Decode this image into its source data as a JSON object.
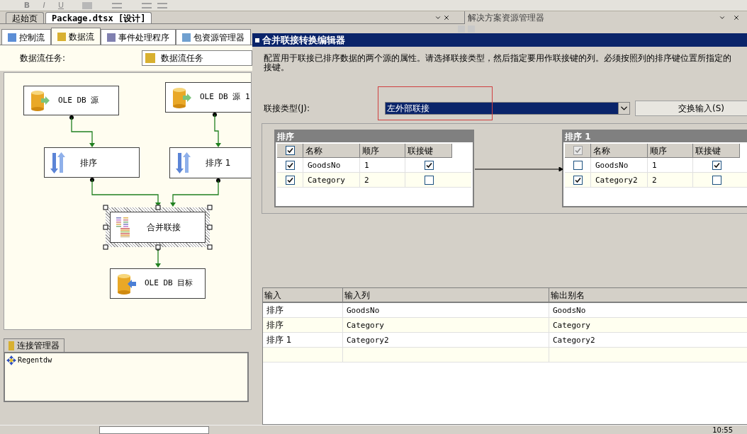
{
  "toolbar": {
    "buttons": [
      "B",
      "I",
      "U"
    ]
  },
  "document_tabs": [
    {
      "label": "起始页",
      "selected": false
    },
    {
      "label": "Package.dtsx [设计]",
      "selected": true
    }
  ],
  "solution_explorer": {
    "title": "解决方案资源管理器"
  },
  "designer_tabs": [
    {
      "label": "控制流",
      "selected": false
    },
    {
      "label": "数据流",
      "selected": true
    },
    {
      "label": "事件处理程序",
      "selected": false
    },
    {
      "label": "包资源管理器",
      "selected": false
    }
  ],
  "task": {
    "label": "数据流任务:",
    "value": "数据流任务"
  },
  "diagram": {
    "nodes": [
      {
        "label": "OLE DB 源",
        "kind": "source",
        "selected": false
      },
      {
        "label": "OLE DB 源 1",
        "kind": "source",
        "selected": false
      },
      {
        "label": "排序",
        "kind": "sort",
        "selected": false
      },
      {
        "label": "排序 1",
        "kind": "sort",
        "selected": false
      },
      {
        "label": "合并联接",
        "kind": "merge",
        "selected": true
      },
      {
        "label": "OLE DB 目标",
        "kind": "destination",
        "selected": false
      }
    ]
  },
  "connection_manager": {
    "tab": "连接管理器",
    "items": [
      "Regentdw"
    ]
  },
  "dialog": {
    "title": "合并联接转换编辑器",
    "description_lines": [
      "配置用于联接已排序数据的两个源的属性。请选择联接类型，然后指定要用作联接键的列。必须按照列的排序键位置所指定的",
      "接键。"
    ],
    "join_type_label": "联接类型(J):",
    "join_type_value": "左外部联接",
    "swap_button": "交换输入(S)",
    "inputs": [
      {
        "title": "排序",
        "header_checked": true,
        "header_disabled": false,
        "columns": [
          "名称",
          "顺序",
          "联接键"
        ],
        "rows": [
          {
            "name": "GoodsNo",
            "order": "1",
            "checked": true,
            "join_key": true
          },
          {
            "name": "Category",
            "order": "2",
            "checked": true,
            "join_key": false
          }
        ]
      },
      {
        "title": "排序 1",
        "header_checked": true,
        "header_disabled": true,
        "columns": [
          "名称",
          "顺序",
          "联接键"
        ],
        "rows": [
          {
            "name": "GoodsNo",
            "order": "1",
            "checked": false,
            "join_key": true
          },
          {
            "name": "Category2",
            "order": "2",
            "checked": true,
            "join_key": false
          }
        ]
      }
    ],
    "output": {
      "columns": [
        "输入",
        "输入列",
        "输出别名"
      ],
      "rows": [
        [
          "排序",
          "GoodsNo",
          "GoodsNo"
        ],
        [
          "排序",
          "Category",
          "Category"
        ],
        [
          "排序 1",
          "Category2",
          "Category2"
        ]
      ]
    }
  },
  "taskbar": {
    "clock": "10:55"
  }
}
